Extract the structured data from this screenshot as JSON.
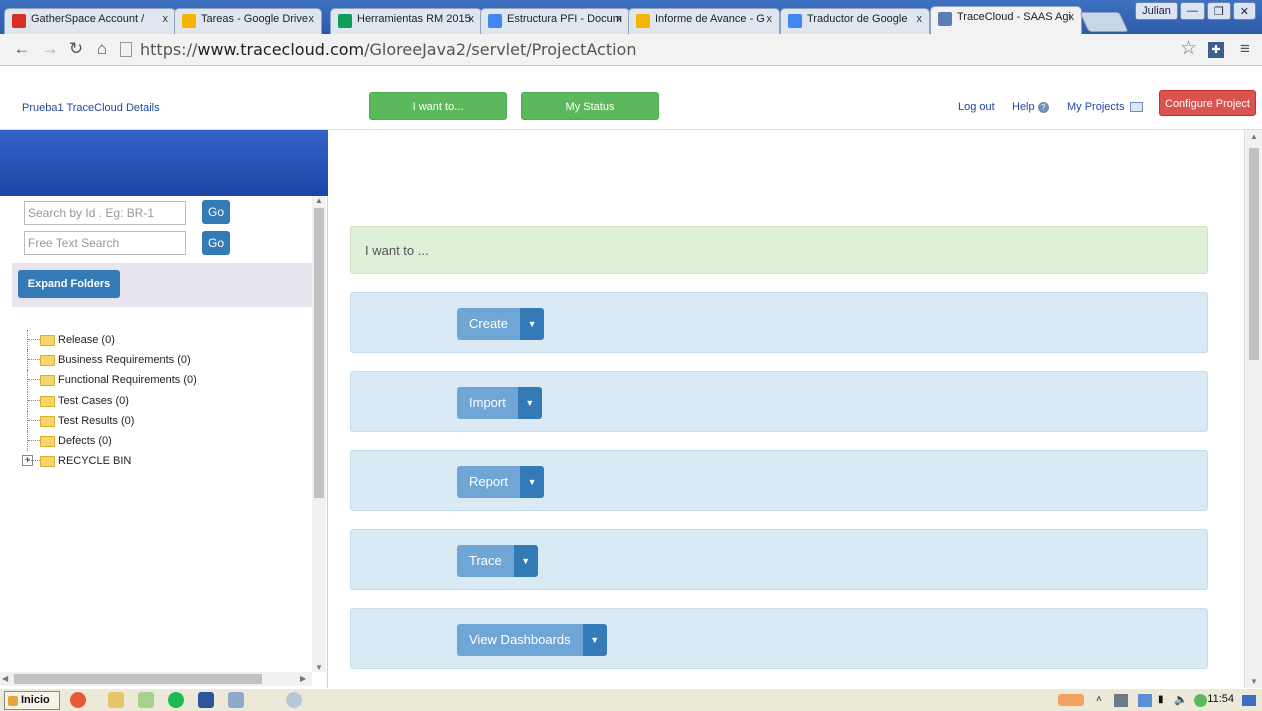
{
  "browser": {
    "tabs": [
      {
        "title": "GatherSpace Account /",
        "favicon_color": "#d93025"
      },
      {
        "title": "Tareas - Google Drive",
        "favicon_color": "#f4b400"
      },
      {
        "title": "Herramientas RM 2015",
        "favicon_color": "#0f9d58"
      },
      {
        "title": "Estructura PFI - Docum",
        "favicon_color": "#4285f4"
      },
      {
        "title": "Informe de Avance - G",
        "favicon_color": "#f4b400"
      },
      {
        "title": "Traductor de Google",
        "favicon_color": "#4285f4"
      },
      {
        "title": "TraceCloud - SAAS Agi",
        "favicon_color": "#5b7fb5",
        "active": true
      }
    ],
    "close_glyph": "x",
    "user_badge": "Julian",
    "url_prefix": "https://",
    "url_domain": "www.tracecloud.com",
    "url_path": "/GloreeJava2/servlet/ProjectAction"
  },
  "header": {
    "project_title": "Prueba1 TraceCloud Details",
    "i_want_button": "I want to...",
    "my_status_button": "My Status",
    "logout": "Log out",
    "help": "Help",
    "my_projects": "My Projects",
    "configure_project": "Configure Project"
  },
  "sidebar": {
    "search_id_placeholder": "Search by Id . Eg: BR-1",
    "free_text_placeholder": "Free Text Search",
    "go_label": "Go",
    "expand_folders": "Expand Folders",
    "tree": [
      {
        "label": "Release (0)"
      },
      {
        "label": "Business Requirements (0)"
      },
      {
        "label": "Functional Requirements (0)"
      },
      {
        "label": "Test Cases (0)"
      },
      {
        "label": "Test Results (0)"
      },
      {
        "label": "Defects (0)"
      },
      {
        "label": "RECYCLE BIN",
        "expandable": true
      }
    ]
  },
  "main": {
    "i_want_heading": "I want to ...",
    "actions": [
      "Create",
      "Import",
      "Report",
      "Trace",
      "View Dashboards"
    ]
  },
  "taskbar": {
    "start_label": "Inicio",
    "clock": "11:54"
  },
  "colors": {
    "green_button": "#5cb85c",
    "configure_red": "#d9534f",
    "primary_blue": "#337ab7",
    "sidebar_band": "#1c45a8"
  }
}
